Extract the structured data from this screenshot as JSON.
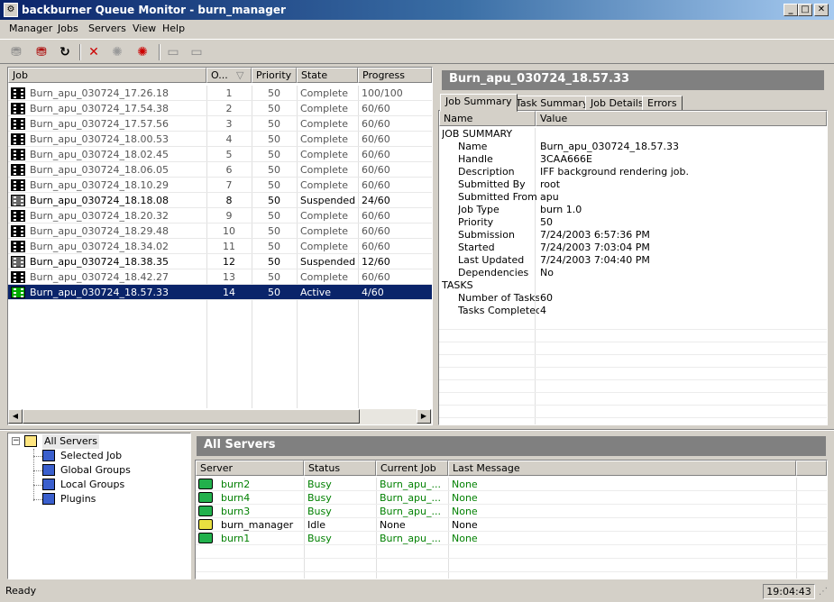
{
  "window": {
    "title": "backburner Queue Monitor - burn_manager",
    "min": "_",
    "max": "□",
    "close": "✕"
  },
  "menu": [
    "Manager",
    "Jobs",
    "Servers",
    "View",
    "Help"
  ],
  "jobs": {
    "columns": [
      "Job",
      "O...",
      "Priority",
      "State",
      "Progress"
    ],
    "rows": [
      {
        "name": "Burn_apu_030724_17.26.18",
        "order": "1",
        "priority": "50",
        "state": "Complete",
        "progress": "100/100",
        "style": "gray"
      },
      {
        "name": "Burn_apu_030724_17.54.38",
        "order": "2",
        "priority": "50",
        "state": "Complete",
        "progress": "60/60",
        "style": "gray"
      },
      {
        "name": "Burn_apu_030724_17.57.56",
        "order": "3",
        "priority": "50",
        "state": "Complete",
        "progress": "60/60",
        "style": "gray"
      },
      {
        "name": "Burn_apu_030724_18.00.53",
        "order": "4",
        "priority": "50",
        "state": "Complete",
        "progress": "60/60",
        "style": "gray"
      },
      {
        "name": "Burn_apu_030724_18.02.45",
        "order": "5",
        "priority": "50",
        "state": "Complete",
        "progress": "60/60",
        "style": "gray"
      },
      {
        "name": "Burn_apu_030724_18.06.05",
        "order": "6",
        "priority": "50",
        "state": "Complete",
        "progress": "60/60",
        "style": "gray"
      },
      {
        "name": "Burn_apu_030724_18.10.29",
        "order": "7",
        "priority": "50",
        "state": "Complete",
        "progress": "60/60",
        "style": "gray"
      },
      {
        "name": "Burn_apu_030724_18.18.08",
        "order": "8",
        "priority": "50",
        "state": "Suspended",
        "progress": "24/60",
        "style": "dark"
      },
      {
        "name": "Burn_apu_030724_18.20.32",
        "order": "9",
        "priority": "50",
        "state": "Complete",
        "progress": "60/60",
        "style": "gray"
      },
      {
        "name": "Burn_apu_030724_18.29.48",
        "order": "10",
        "priority": "50",
        "state": "Complete",
        "progress": "60/60",
        "style": "gray"
      },
      {
        "name": "Burn_apu_030724_18.34.02",
        "order": "11",
        "priority": "50",
        "state": "Complete",
        "progress": "60/60",
        "style": "gray"
      },
      {
        "name": "Burn_apu_030724_18.38.35",
        "order": "12",
        "priority": "50",
        "state": "Suspended",
        "progress": "12/60",
        "style": "dark"
      },
      {
        "name": "Burn_apu_030724_18.42.27",
        "order": "13",
        "priority": "50",
        "state": "Complete",
        "progress": "60/60",
        "style": "gray"
      },
      {
        "name": "Burn_apu_030724_18.57.33",
        "order": "14",
        "priority": "50",
        "state": "Active",
        "progress": "4/60",
        "style": "selected"
      }
    ]
  },
  "details": {
    "title": "Burn_apu_030724_18.57.33",
    "tabs": [
      "Job Summary",
      "Task Summary",
      "Job Details",
      "Errors"
    ],
    "columns": [
      "Name",
      "Value"
    ],
    "rows": [
      {
        "name": "JOB SUMMARY",
        "value": "",
        "section": true
      },
      {
        "name": "Name",
        "value": "Burn_apu_030724_18.57.33"
      },
      {
        "name": "Handle",
        "value": "3CAA666E"
      },
      {
        "name": "Description",
        "value": "IFF background rendering job."
      },
      {
        "name": "Submitted By",
        "value": "root"
      },
      {
        "name": "Submitted From",
        "value": "apu"
      },
      {
        "name": "Job Type",
        "value": "burn 1.0"
      },
      {
        "name": "Priority",
        "value": "50"
      },
      {
        "name": "Submission",
        "value": "7/24/2003 6:57:36 PM"
      },
      {
        "name": "Started",
        "value": "7/24/2003 7:03:04 PM"
      },
      {
        "name": "Last Updated",
        "value": "7/24/2003 7:04:40 PM"
      },
      {
        "name": "Dependencies",
        "value": "No"
      },
      {
        "name": "TASKS",
        "value": "",
        "section": true
      },
      {
        "name": "Number of Tasks",
        "value": "60"
      },
      {
        "name": "Tasks Completed",
        "value": "4"
      }
    ]
  },
  "tree": {
    "root": "All Servers",
    "toggle": "−",
    "children": [
      "Selected Job",
      "Global Groups",
      "Local Groups",
      "Plugins"
    ]
  },
  "servers": {
    "title": "All Servers",
    "columns": [
      "Server",
      "Status",
      "Current Job",
      "Last Message"
    ],
    "rows": [
      {
        "server": "burn2",
        "status": "Busy",
        "job": "Burn_apu_...",
        "message": "None",
        "busy": true
      },
      {
        "server": "burn4",
        "status": "Busy",
        "job": "Burn_apu_...",
        "message": "None",
        "busy": true
      },
      {
        "server": "burn3",
        "status": "Busy",
        "job": "Burn_apu_...",
        "message": "None",
        "busy": true
      },
      {
        "server": "burn_manager",
        "status": "Idle",
        "job": "None",
        "message": "None",
        "busy": false
      },
      {
        "server": "burn1",
        "status": "Busy",
        "job": "Burn_apu_...",
        "message": "None",
        "busy": true
      }
    ]
  },
  "status": {
    "text": "Ready",
    "time": "19:04:43"
  },
  "colors": {
    "title_active": "#0a246a",
    "selection": "#0a246a",
    "busy": "#008000"
  }
}
